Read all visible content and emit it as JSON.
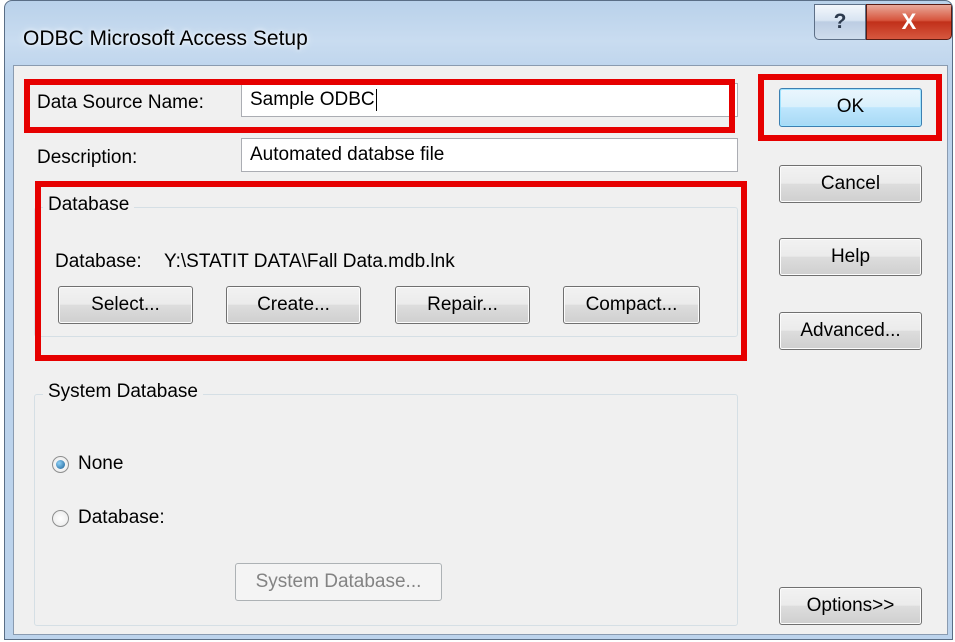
{
  "window": {
    "title": "ODBC Microsoft Access Setup",
    "help_glyph": "?",
    "close_glyph": "X"
  },
  "form": {
    "dsn_label": "Data Source Name:",
    "dsn_value": "Sample ODBC",
    "desc_label": "Description:",
    "desc_value": "Automated databse file"
  },
  "database_group": {
    "legend": "Database",
    "path_label": "Database:",
    "path_value": "Y:\\STATIT DATA\\Fall Data.mdb.lnk",
    "buttons": {
      "select": "Select...",
      "create": "Create...",
      "repair": "Repair...",
      "compact": "Compact..."
    }
  },
  "system_group": {
    "legend": "System Database",
    "radio_none": "None",
    "radio_database": "Database:",
    "selected": "None",
    "system_db_button": "System Database..."
  },
  "side_buttons": {
    "ok": "OK",
    "cancel": "Cancel",
    "help": "Help",
    "advanced": "Advanced...",
    "options": "Options>>"
  },
  "colors": {
    "highlight": "#e60000",
    "default_button_border": "#3c7fb1",
    "close_button": "#c1301a"
  }
}
